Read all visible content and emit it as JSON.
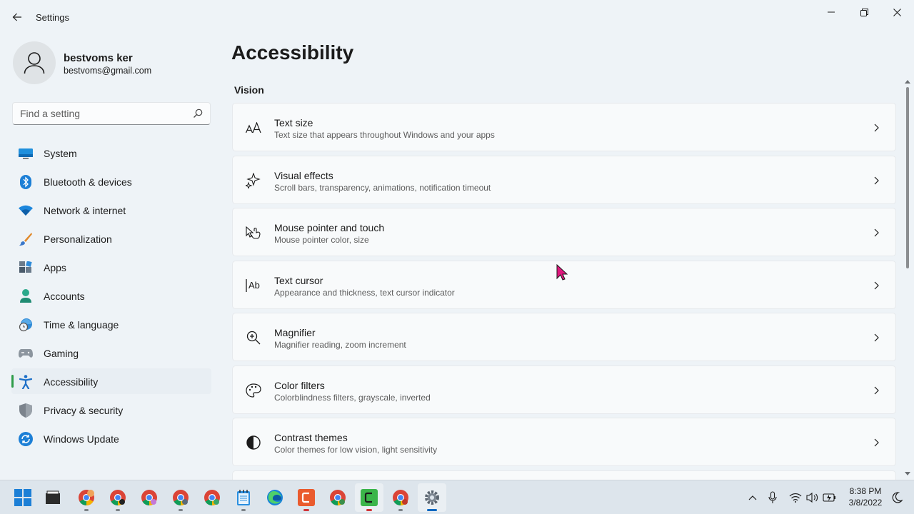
{
  "window": {
    "app_title": "Settings",
    "controls": [
      "minimize",
      "restore",
      "close"
    ]
  },
  "profile": {
    "name": "bestvoms ker",
    "email": "bestvoms@gmail.com"
  },
  "search": {
    "placeholder": "Find a setting",
    "value": ""
  },
  "sidebar": {
    "items": [
      {
        "label": "System",
        "icon": "monitor-icon",
        "selected": false
      },
      {
        "label": "Bluetooth & devices",
        "icon": "bluetooth-icon",
        "selected": false
      },
      {
        "label": "Network & internet",
        "icon": "wifi-icon",
        "selected": false
      },
      {
        "label": "Personalization",
        "icon": "brush-icon",
        "selected": false
      },
      {
        "label": "Apps",
        "icon": "apps-icon",
        "selected": false
      },
      {
        "label": "Accounts",
        "icon": "person-icon",
        "selected": false
      },
      {
        "label": "Time & language",
        "icon": "globe-clock-icon",
        "selected": false
      },
      {
        "label": "Gaming",
        "icon": "controller-icon",
        "selected": false
      },
      {
        "label": "Accessibility",
        "icon": "accessibility-icon",
        "selected": true
      },
      {
        "label": "Privacy & security",
        "icon": "shield-icon",
        "selected": false
      },
      {
        "label": "Windows Update",
        "icon": "update-icon",
        "selected": false
      }
    ]
  },
  "main": {
    "title": "Accessibility",
    "section": "Vision",
    "cards": [
      {
        "title": "Text size",
        "desc": "Text size that appears throughout Windows and your apps",
        "icon": "text-size-icon"
      },
      {
        "title": "Visual effects",
        "desc": "Scroll bars, transparency, animations, notification timeout",
        "icon": "sparkle-icon"
      },
      {
        "title": "Mouse pointer and touch",
        "desc": "Mouse pointer color, size",
        "icon": "pointer-touch-icon"
      },
      {
        "title": "Text cursor",
        "desc": "Appearance and thickness, text cursor indicator",
        "icon": "text-cursor-icon"
      },
      {
        "title": "Magnifier",
        "desc": "Magnifier reading, zoom increment",
        "icon": "magnifier-icon"
      },
      {
        "title": "Color filters",
        "desc": "Colorblindness filters, grayscale, inverted",
        "icon": "palette-icon"
      },
      {
        "title": "Contrast themes",
        "desc": "Color themes for low vision, light sensitivity",
        "icon": "contrast-icon"
      }
    ]
  },
  "taskbar": {
    "apps": [
      "start-icon",
      "file-explorer-icon",
      "chrome-icon",
      "chrome-icon",
      "chrome-icon",
      "chrome-icon",
      "chrome-icon",
      "notepad-icon",
      "edge-icon",
      "app-orange-icon",
      "chrome-icon",
      "app-green-icon",
      "chrome-icon",
      "settings-gear-icon"
    ],
    "time": "8:38 PM",
    "date": "3/8/2022"
  },
  "colors": {
    "accent": "#2e9c48",
    "background": "#eef3f7",
    "card": "#f8fafb",
    "taskbar": "#dde5ec"
  }
}
